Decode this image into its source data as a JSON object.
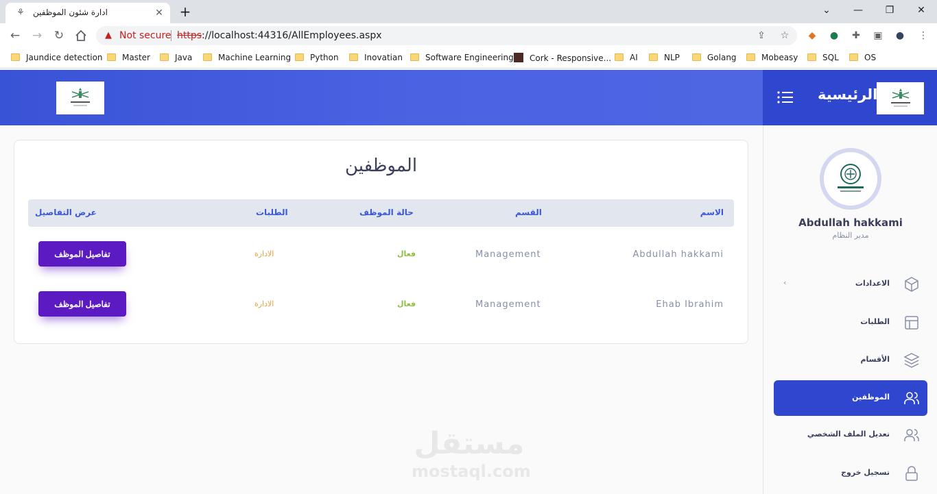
{
  "browser": {
    "tab_title": "ادارة شئون الموظفين",
    "security_label": "Not secure",
    "url_scheme": "https",
    "url_rest": "://localhost:44316/AllEmployees.aspx",
    "bookmarks": [
      "Jaundice detection",
      "Master",
      "Java",
      "Machine Learning",
      "Python",
      "Inovatian",
      "Software Engineering",
      "Cork - Responsive...",
      "AI",
      "NLP",
      "Golang",
      "Mobeasy",
      "SQL",
      "OS"
    ]
  },
  "header": {
    "home_title": "الرئيسية"
  },
  "main": {
    "title": "الموظفين",
    "columns": {
      "name": "الاسم",
      "department": "القسم",
      "status": "حالة الموظف",
      "requests": "الطلبات",
      "details": "عرض التفاصيل"
    },
    "rows": [
      {
        "name": "Abdullah hakkami",
        "department": "Management",
        "status": "فعال",
        "requests": "الادارة",
        "button": "تفاصيل الموظف"
      },
      {
        "name": "Ehab Ibrahim",
        "department": "Management",
        "status": "فعال",
        "requests": "الادارة",
        "button": "تفاصيل الموظف"
      }
    ]
  },
  "watermark": {
    "arabic": "مستقل",
    "latin": "mostaql.com"
  },
  "sidebar": {
    "user_name": "Abdullah hakkami",
    "user_role": "مدير النظام",
    "items": [
      {
        "label": "الاعدادات",
        "icon": "box-icon"
      },
      {
        "label": "الطلبات",
        "icon": "layout-icon"
      },
      {
        "label": "الأقسام",
        "icon": "layers-icon"
      },
      {
        "label": "الموظفين",
        "icon": "users-icon",
        "active": true
      },
      {
        "label": "تعديل الملف الشخصي",
        "icon": "users-icon"
      },
      {
        "label": "تسجيل خروج",
        "icon": "lock-icon"
      }
    ]
  },
  "colors": {
    "primary": "#2f46cf",
    "header_gradient": "#4a63e3",
    "button": "#5c1ac3",
    "status_active": "#8dbf42",
    "requests_text": "#e2a03f",
    "table_header_bg": "#e1e6ef"
  }
}
